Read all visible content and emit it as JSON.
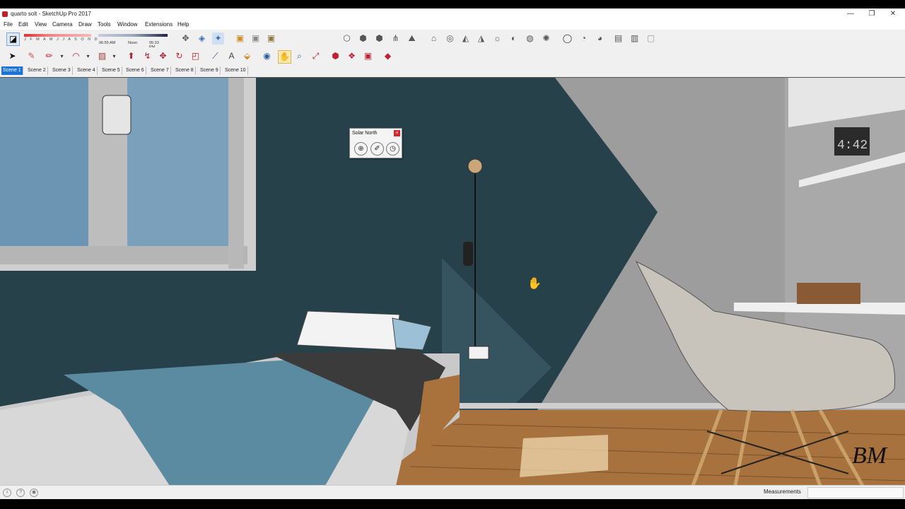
{
  "window": {
    "title": "quarto solt - SketchUp Pro 2017",
    "minimize_label": "—",
    "restore_label": "❐",
    "close_label": "✕"
  },
  "menu": [
    "File",
    "Edit",
    "View",
    "Camera",
    "Draw",
    "Tools",
    "Window",
    "Extensions",
    "Help"
  ],
  "shadow_settings": {
    "months": "J F M A M J J A S O N D",
    "time_start": "06:55 AM",
    "time_mid": "Noon",
    "time_end": "05:33 PM"
  },
  "scenes": [
    "Scene 1",
    "Scene 2",
    "Scene 3",
    "Scene 4",
    "Scene 5",
    "Scene 6",
    "Scene 7",
    "Scene 8",
    "Scene 9",
    "Scene 10"
  ],
  "active_scene": "Scene 1",
  "solar_north": {
    "title": "Solar North",
    "close_label": "×",
    "icons": [
      "compass-icon",
      "pencil-angle-icon",
      "angle-input-icon"
    ]
  },
  "scene": {
    "clock_text": "4:42",
    "signature": "BM"
  },
  "statusbar": {
    "measurements_label": "Measurements",
    "measurements_value": ""
  },
  "colors": {
    "active_tab": "#1c74d8",
    "wall_teal": "#27414a",
    "wall_gray": "#9a9a9a",
    "floor_wood": "#a8723e",
    "blanket_blue": "#5b8ba0",
    "sky": "#6b95b2"
  }
}
